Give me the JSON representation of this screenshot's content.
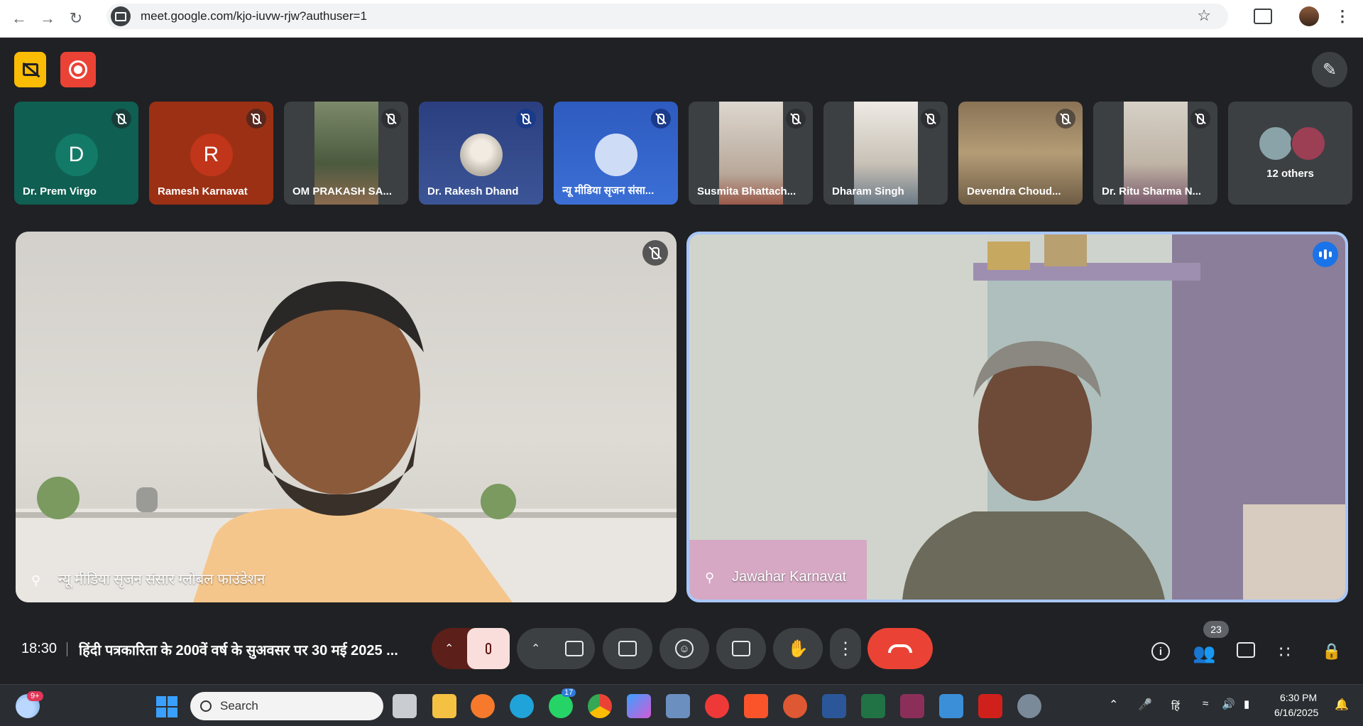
{
  "browser": {
    "url": "meet.google.com/kjo-iuvw-rjw?authuser=1"
  },
  "participants": [
    {
      "name": "Dr. Prem Virgo",
      "initial": "D",
      "bg": "#0f6e5e",
      "avatar_color": "#137a68"
    },
    {
      "name": "Ramesh Karnavat",
      "initial": "R",
      "bg": "#b7391a",
      "avatar_color": "#c1351b"
    },
    {
      "name": "OM PRAKASH SA...",
      "video": "#6b7a5e"
    },
    {
      "name": "Dr. Rakesh Dhand",
      "video": "#33477e"
    },
    {
      "name": "न्यू मीडिया सृजन संसा...",
      "avatar": true
    },
    {
      "name": "Susmita Bhattach...",
      "video": "#c9c4bd"
    },
    {
      "name": "Dharam Singh",
      "video": "#d8d4cd"
    },
    {
      "name": "Devendra Choud...",
      "video": "#a58e6c"
    },
    {
      "name": "Dr. Ritu Sharma N...",
      "video": "#c8c2b6"
    }
  ],
  "others": {
    "label": "12 others"
  },
  "main_tiles": {
    "left_name": "न्यू मीडिया सृजन संसार ग्लोबल फाउंडेशन",
    "right_name": "Jawahar Karnavat"
  },
  "controls": {
    "time": "18:30",
    "meeting_title": "हिंदी पत्रकारिता के 200वें वर्ष के सुअवसर पर 30 मई 2025 ...",
    "people_count": "23"
  },
  "taskbar": {
    "weather_badge": "9+",
    "search_placeholder": "Search",
    "whatsapp_badge": "17",
    "lang": "हिं",
    "time": "6:30 PM",
    "date": "6/16/2025"
  },
  "colors": {
    "meet_bg": "#202124",
    "accent_blue": "#a8c7fa",
    "end_call": "#ea4335",
    "record": "#ea4335",
    "captions_off": "#fbbc04"
  }
}
